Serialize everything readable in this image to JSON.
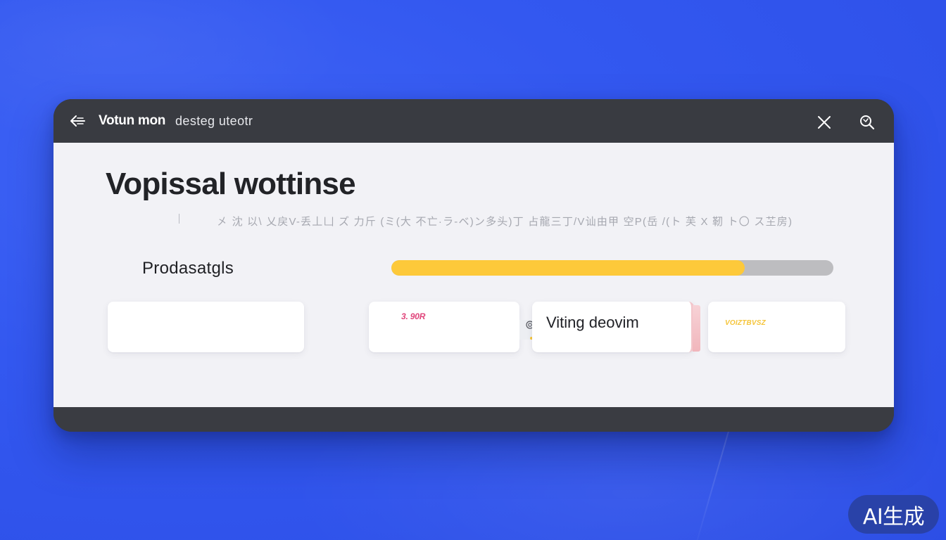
{
  "titlebar": {
    "app_name": "Votun mon",
    "subtitle": "desteg uteotr"
  },
  "main": {
    "title": "Vopissal wottinse",
    "subtitle": "㐅 沈 以\\ 乂戻V-丢丄凵    ズ 力斤 (ミ(大 不亡·ラ-ベ)ン多头)丁 占龍三丁/V讪由甲 空P(岳 /(ト 芙 X 靭 ト〇 ス芏房)"
  },
  "progress": {
    "label": "Prodasatgls",
    "percent": 80
  },
  "cards": {
    "card2_value": "3. 90R",
    "card3_label": "Viting deovim",
    "card4_value": "VOIZTBVSZ"
  },
  "badge": {
    "label": "AI生成"
  },
  "colors": {
    "background": "#3358f0",
    "window_chrome": "#393b41",
    "content_bg": "#f2f2f6",
    "progress_fill": "#fdc93a",
    "progress_track": "#bdbdc0",
    "accent_pink": "#e0457b"
  },
  "icons": {
    "back": "arrow-left-icon",
    "close": "close-icon",
    "search": "search-icon",
    "link": "link-icon"
  }
}
